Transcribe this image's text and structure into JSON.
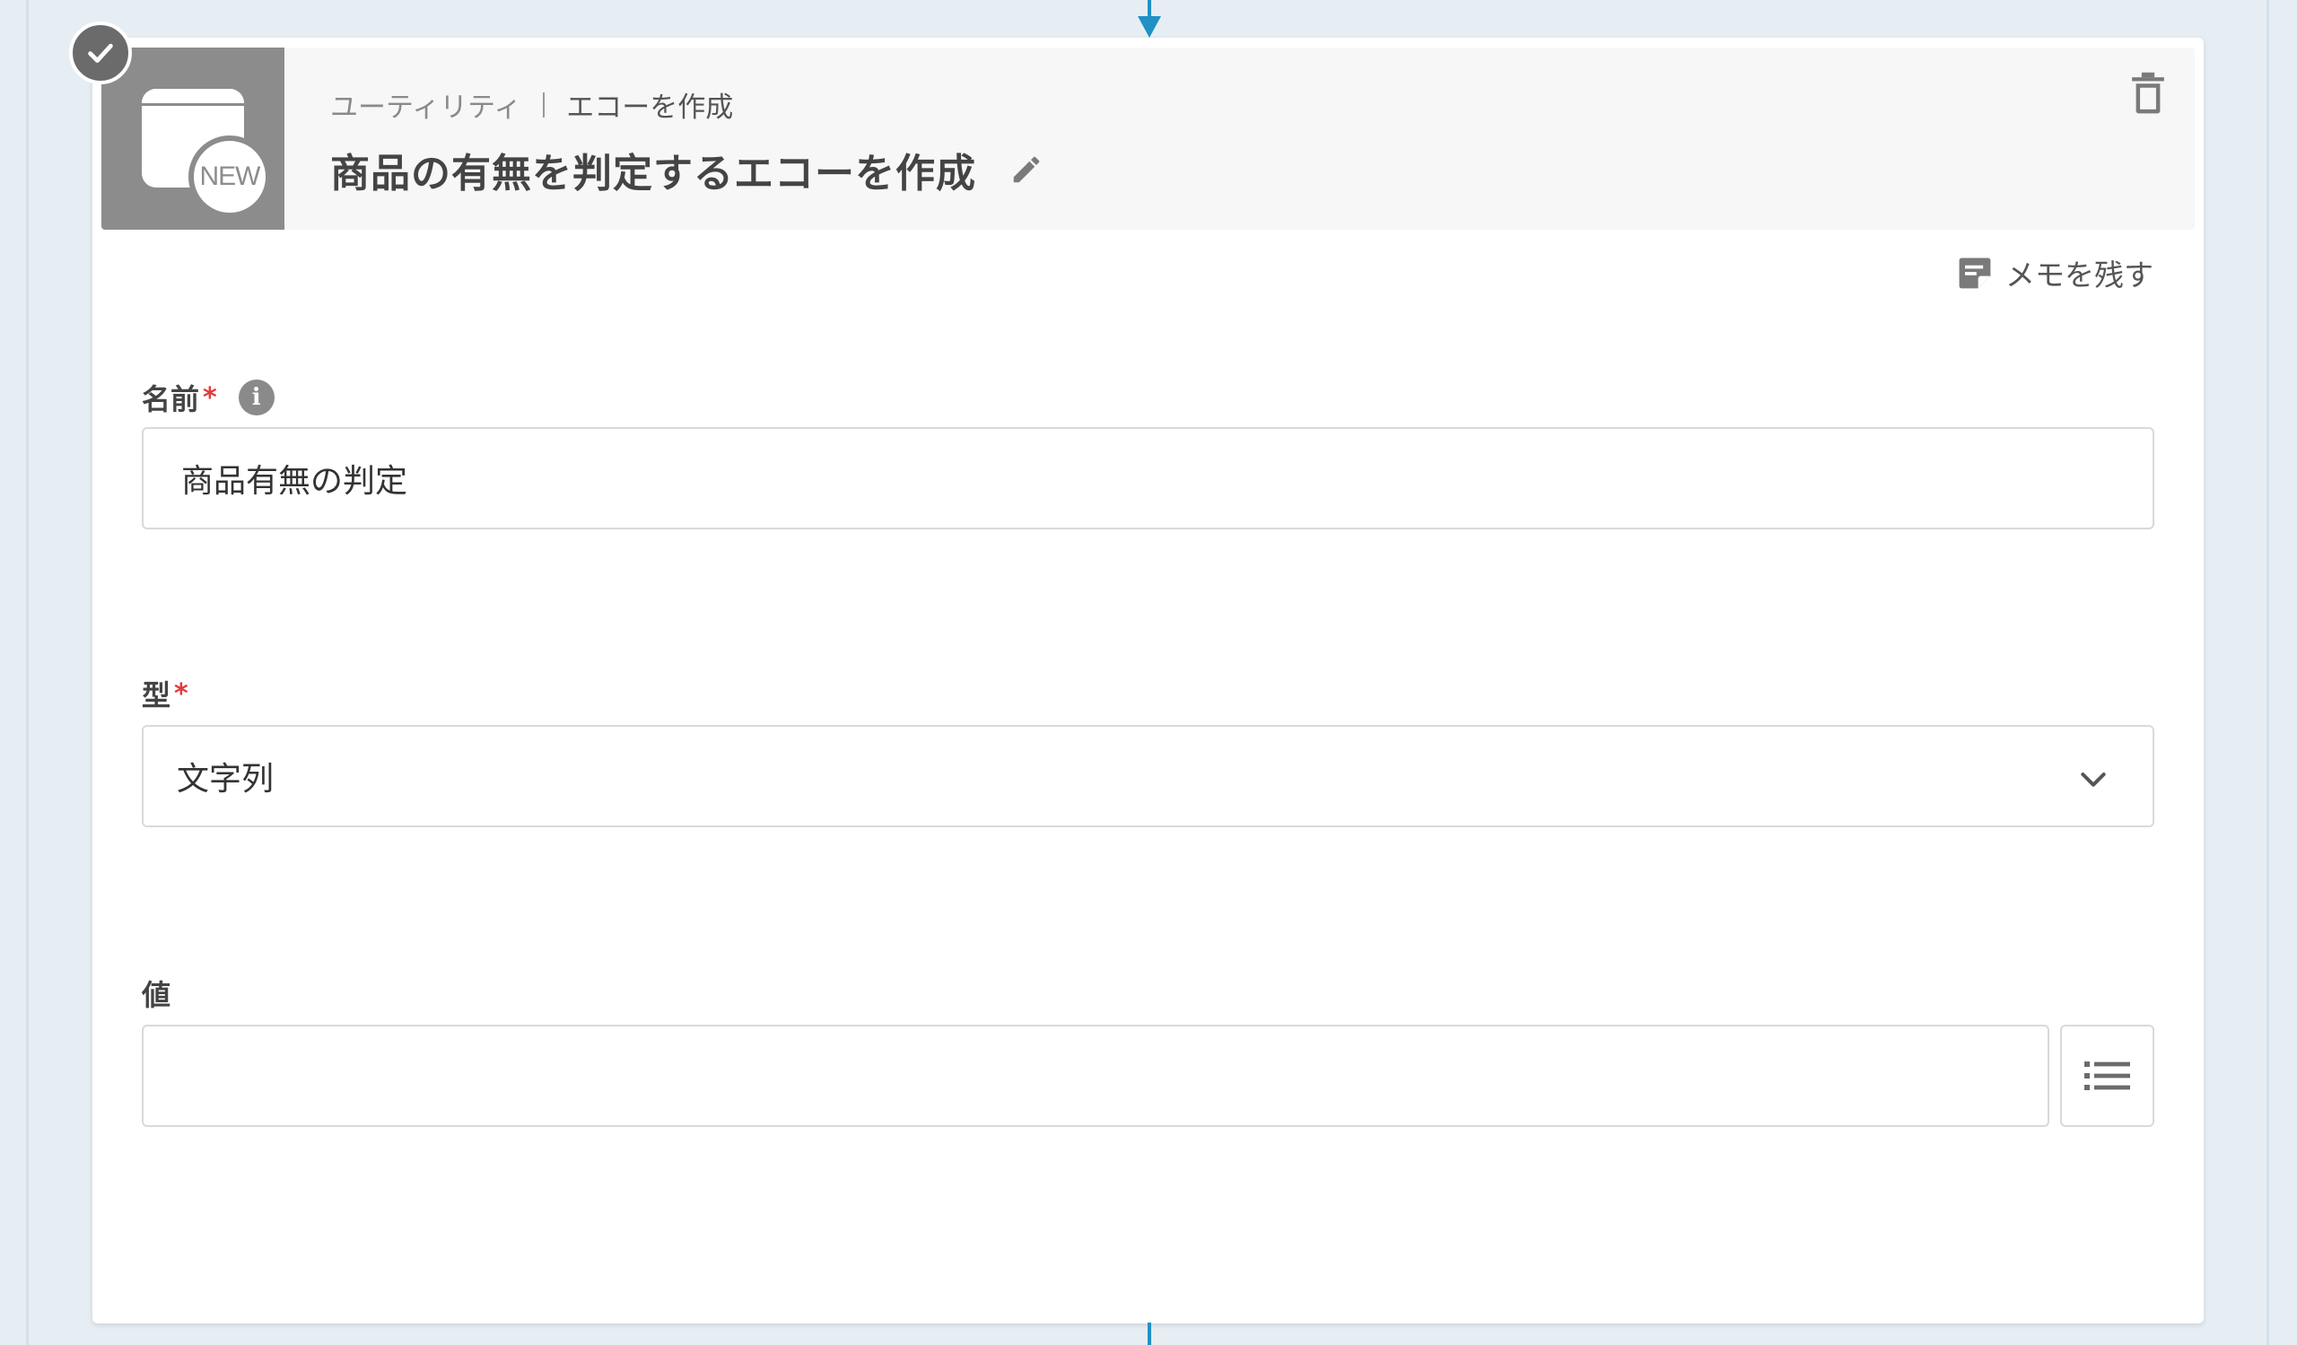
{
  "breadcrumb": {
    "category": "ユーティリティ",
    "action": "エコーを作成"
  },
  "header": {
    "title": "商品の有無を判定するエコーを作成",
    "icon_badge": "NEW",
    "status_icon": "check-icon"
  },
  "memo": {
    "label": "メモを残す"
  },
  "fields": {
    "name": {
      "label": "名前",
      "required_mark": "*",
      "info_glyph": "i",
      "value": "商品有無の判定"
    },
    "type": {
      "label": "型",
      "required_mark": "*",
      "selected": "文字列"
    },
    "value": {
      "label": "値",
      "value": ""
    }
  },
  "colors": {
    "connector": "#2190c5",
    "required": "#e03b3b",
    "icon_bg": "#8c8c8c",
    "background": "#e6eef4"
  }
}
